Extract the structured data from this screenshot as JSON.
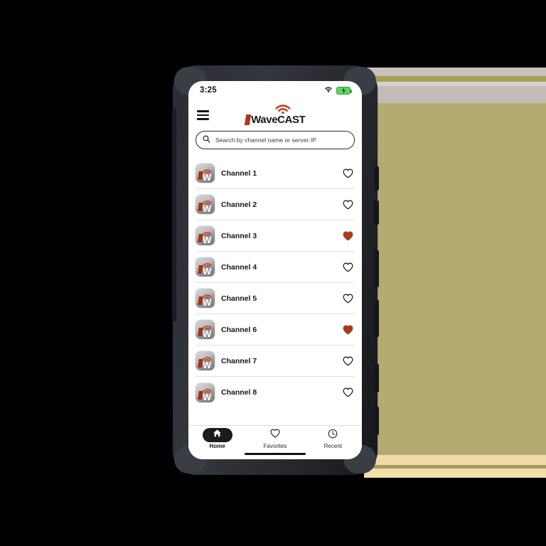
{
  "background": {
    "base_color": "#000000",
    "khaki_color": "#b5ab70",
    "cream_color": "#f2dea8"
  },
  "device": {
    "name": "rugged-phone-case",
    "case_color": "#2b2d33"
  },
  "status_bar": {
    "time": "3:25",
    "wifi_icon": "wifi-icon",
    "battery_icon": "battery-charging-icon",
    "battery_color": "#5fd35f"
  },
  "header": {
    "menu_icon": "hamburger-menu-icon",
    "logo": {
      "mark": "wavecast-slash-mark",
      "text": "WaveCAST",
      "arcs_icon": "wifi-arcs-icon",
      "accent_color": "#a93a20"
    }
  },
  "search": {
    "icon": "search-icon",
    "placeholder": "Search by channel name or server IP",
    "value": ""
  },
  "channels": [
    {
      "name": "Channel 1",
      "icon": "wavecast-app-icon",
      "favorite": false
    },
    {
      "name": "Channel 2",
      "icon": "wavecast-app-icon",
      "favorite": false
    },
    {
      "name": "Channel 3",
      "icon": "wavecast-app-icon",
      "favorite": true
    },
    {
      "name": "Channel 4",
      "icon": "wavecast-app-icon",
      "favorite": false
    },
    {
      "name": "Channel 5",
      "icon": "wavecast-app-icon",
      "favorite": false
    },
    {
      "name": "Channel 6",
      "icon": "wavecast-app-icon",
      "favorite": true
    },
    {
      "name": "Channel 7",
      "icon": "wavecast-app-icon",
      "favorite": false
    },
    {
      "name": "Channel 8",
      "icon": "wavecast-app-icon",
      "favorite": false
    }
  ],
  "favorite_color": "#a93a20",
  "bottom_nav": {
    "items": [
      {
        "label": "Home",
        "icon": "home-icon",
        "active": true
      },
      {
        "label": "Favorites",
        "icon": "heart-icon",
        "active": false
      },
      {
        "label": "Recent",
        "icon": "clock-icon",
        "active": false
      }
    ]
  }
}
